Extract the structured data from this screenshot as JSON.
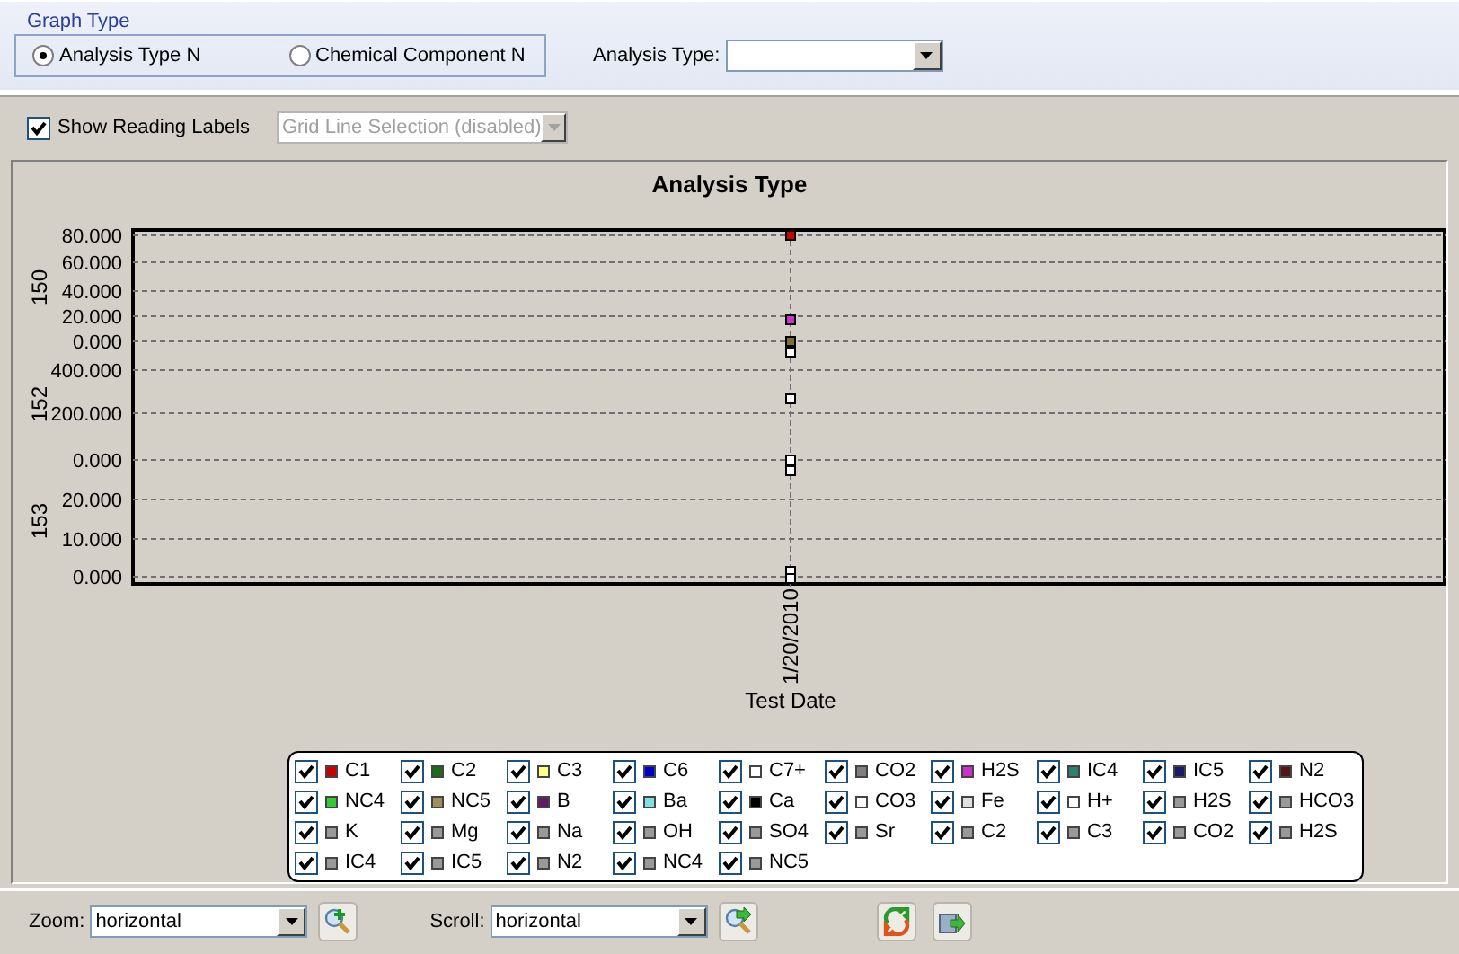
{
  "graph_type": {
    "title": "Graph Type",
    "options": [
      {
        "label": "Analysis Type N",
        "selected": true
      },
      {
        "label": "Chemical Component N",
        "selected": false
      }
    ],
    "analysis_type": {
      "label": "Analysis Type:"
    }
  },
  "options_bar": {
    "show_reading_labels": {
      "label": "Show Reading Labels",
      "checked": true
    },
    "grid_line_selection": {
      "value": "Grid Line Selection (disabled)",
      "disabled": true
    }
  },
  "chart": {
    "title": "Analysis Type",
    "panes": [
      {
        "label": "150",
        "yticks": [
          "80.000",
          "60.000",
          "40.000",
          "20.000",
          "0.000"
        ]
      },
      {
        "label": "152",
        "yticks": [
          "400.000",
          "200.000",
          "0.000"
        ]
      },
      {
        "label": "153",
        "yticks": [
          "20.000",
          "10.000",
          "0.000"
        ]
      }
    ],
    "xtick": "1/20/2010",
    "xlabel": "Test Date",
    "points": [
      {
        "color": "#cc0000"
      },
      {
        "color": "#cc33cc"
      },
      {
        "color": "#807030"
      },
      {
        "color": "#ffffff"
      },
      {
        "color": "#ffffff"
      },
      {
        "color": "#ffffff"
      },
      {
        "color": "#ffffff"
      },
      {
        "color": "#ffffff"
      },
      {
        "color": "#ffffff"
      }
    ]
  },
  "legend": {
    "items": [
      {
        "label": "C1",
        "checked": true,
        "color": "#cc0000"
      },
      {
        "label": "C2",
        "checked": true,
        "color": "#1a6b1a"
      },
      {
        "label": "C3",
        "checked": true,
        "color": "#ffff80"
      },
      {
        "label": "C6",
        "checked": true,
        "color": "#0000cc"
      },
      {
        "label": "C7+",
        "checked": true,
        "color": "#ffffff"
      },
      {
        "label": "CO2",
        "checked": true,
        "color": "#808080"
      },
      {
        "label": "H2S",
        "checked": true,
        "color": "#cc33cc"
      },
      {
        "label": "IC4",
        "checked": true,
        "color": "#2f7f6f"
      },
      {
        "label": "IC5",
        "checked": true,
        "color": "#1a1a66"
      },
      {
        "label": "N2",
        "checked": true,
        "color": "#551515"
      },
      {
        "label": "NC4",
        "checked": true,
        "color": "#33cc33"
      },
      {
        "label": "NC5",
        "checked": true,
        "color": "#a09060"
      },
      {
        "label": "B",
        "checked": true,
        "color": "#661a66"
      },
      {
        "label": "Ba",
        "checked": true,
        "color": "#80e0e0"
      },
      {
        "label": "Ca",
        "checked": true,
        "color": "#000000"
      },
      {
        "label": "CO3",
        "checked": true,
        "color": "#ffffff"
      },
      {
        "label": "Fe",
        "checked": true,
        "color": "#e0e0e0"
      },
      {
        "label": "H+",
        "checked": true,
        "color": "#ffffff"
      },
      {
        "label": "H2S",
        "checked": true,
        "color": "#999999"
      },
      {
        "label": "HCO3",
        "checked": true,
        "color": "#999999"
      },
      {
        "label": "K",
        "checked": true,
        "color": "#999999"
      },
      {
        "label": "Mg",
        "checked": true,
        "color": "#999999"
      },
      {
        "label": "Na",
        "checked": true,
        "color": "#999999"
      },
      {
        "label": "OH",
        "checked": true,
        "color": "#999999"
      },
      {
        "label": "SO4",
        "checked": true,
        "color": "#999999"
      },
      {
        "label": "Sr",
        "checked": true,
        "color": "#999999"
      },
      {
        "label": "C2",
        "checked": true,
        "color": "#999999"
      },
      {
        "label": "C3",
        "checked": true,
        "color": "#999999"
      },
      {
        "label": "CO2",
        "checked": true,
        "color": "#999999"
      },
      {
        "label": "H2S",
        "checked": true,
        "color": "#999999"
      },
      {
        "label": "IC4",
        "checked": true,
        "color": "#999999"
      },
      {
        "label": "IC5",
        "checked": true,
        "color": "#999999"
      },
      {
        "label": "N2",
        "checked": true,
        "color": "#999999"
      },
      {
        "label": "NC4",
        "checked": true,
        "color": "#999999"
      },
      {
        "label": "NC5",
        "checked": true,
        "color": "#999999"
      }
    ]
  },
  "toolbar": {
    "zoom": {
      "label": "Zoom:",
      "value": "horizontal"
    },
    "scroll": {
      "label": "Scroll:",
      "value": "horizontal"
    }
  }
}
